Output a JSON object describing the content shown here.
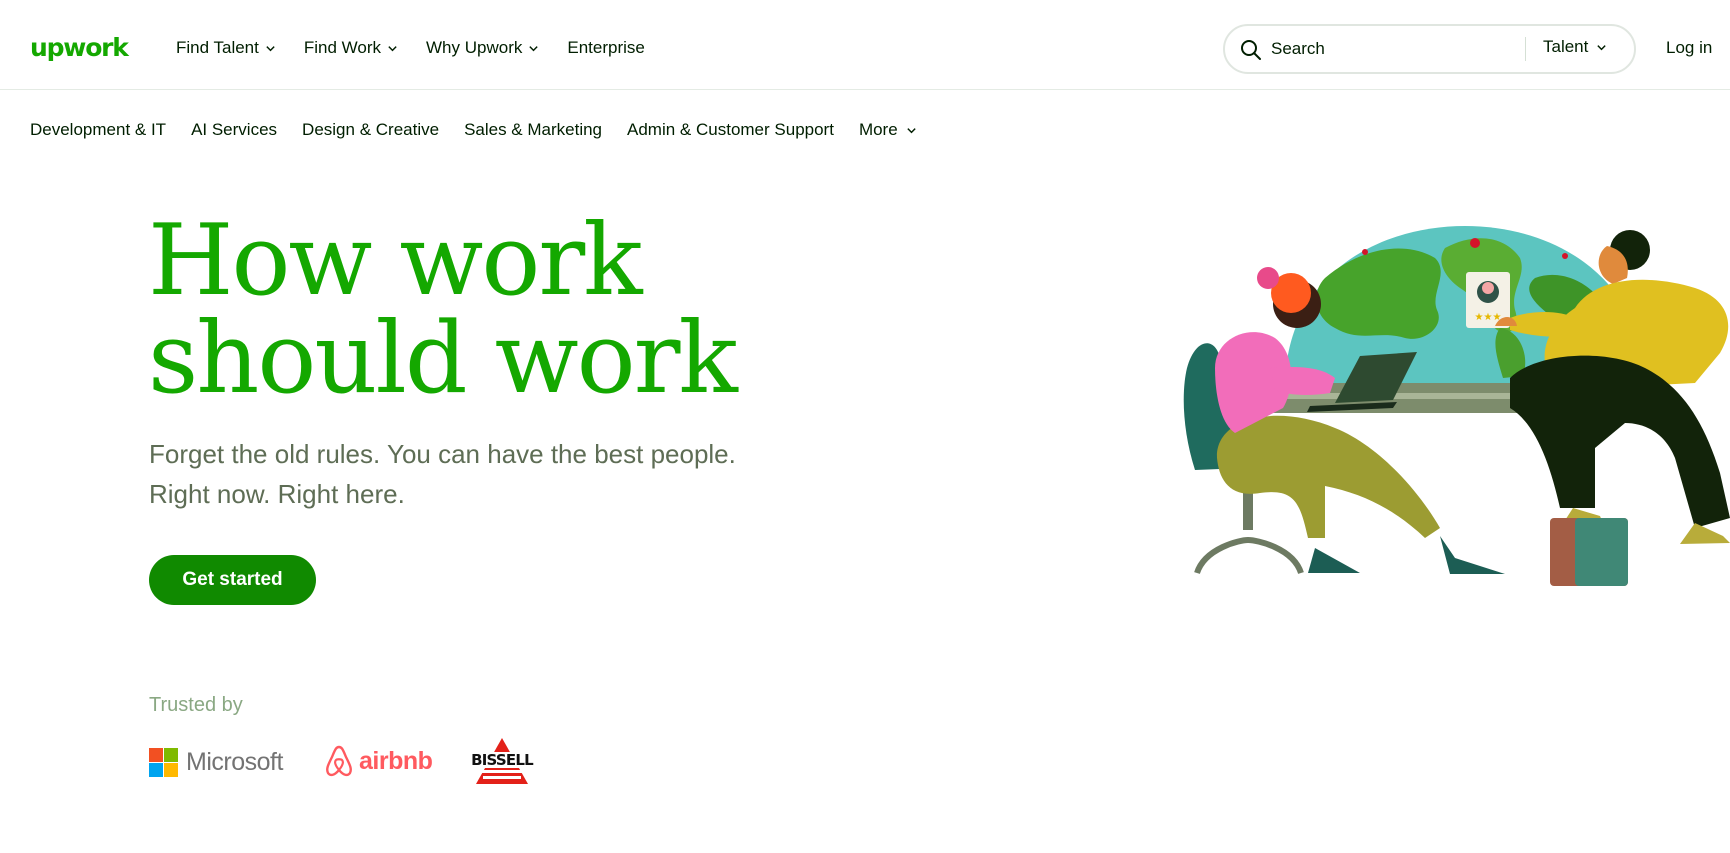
{
  "header": {
    "logo_text": "upwork",
    "nav": [
      {
        "label": "Find Talent",
        "dropdown": true
      },
      {
        "label": "Find Work",
        "dropdown": true
      },
      {
        "label": "Why Upwork",
        "dropdown": true
      },
      {
        "label": "Enterprise",
        "dropdown": false
      }
    ],
    "search": {
      "placeholder": "Search",
      "type_label": "Talent"
    },
    "login_label": "Log in"
  },
  "categories": [
    {
      "label": "Development & IT"
    },
    {
      "label": "AI Services"
    },
    {
      "label": "Design & Creative"
    },
    {
      "label": "Sales & Marketing"
    },
    {
      "label": "Admin & Customer Support"
    },
    {
      "label": "More",
      "dropdown": true
    }
  ],
  "hero": {
    "title_line1": "How work",
    "title_line2": "should work",
    "subtitle_line1": "Forget the old rules. You can have the best people.",
    "subtitle_line2": "Right now. Right here.",
    "cta_label": "Get started"
  },
  "trusted": {
    "label": "Trusted by",
    "brands": [
      {
        "name": "Microsoft",
        "icon": "microsoft-logo"
      },
      {
        "name": "airbnb",
        "icon": "airbnb-logo"
      },
      {
        "name": "Bissell",
        "icon": "bissell-logo"
      }
    ]
  },
  "colors": {
    "brand_green": "#14a800",
    "cta_green": "#108a00",
    "text_dark": "#001e00",
    "subtitle_gray": "#5e6d55",
    "airbnb_red": "#ff5a5f"
  },
  "illustration": {
    "icon": "hero-illustration-two-people-globe"
  }
}
